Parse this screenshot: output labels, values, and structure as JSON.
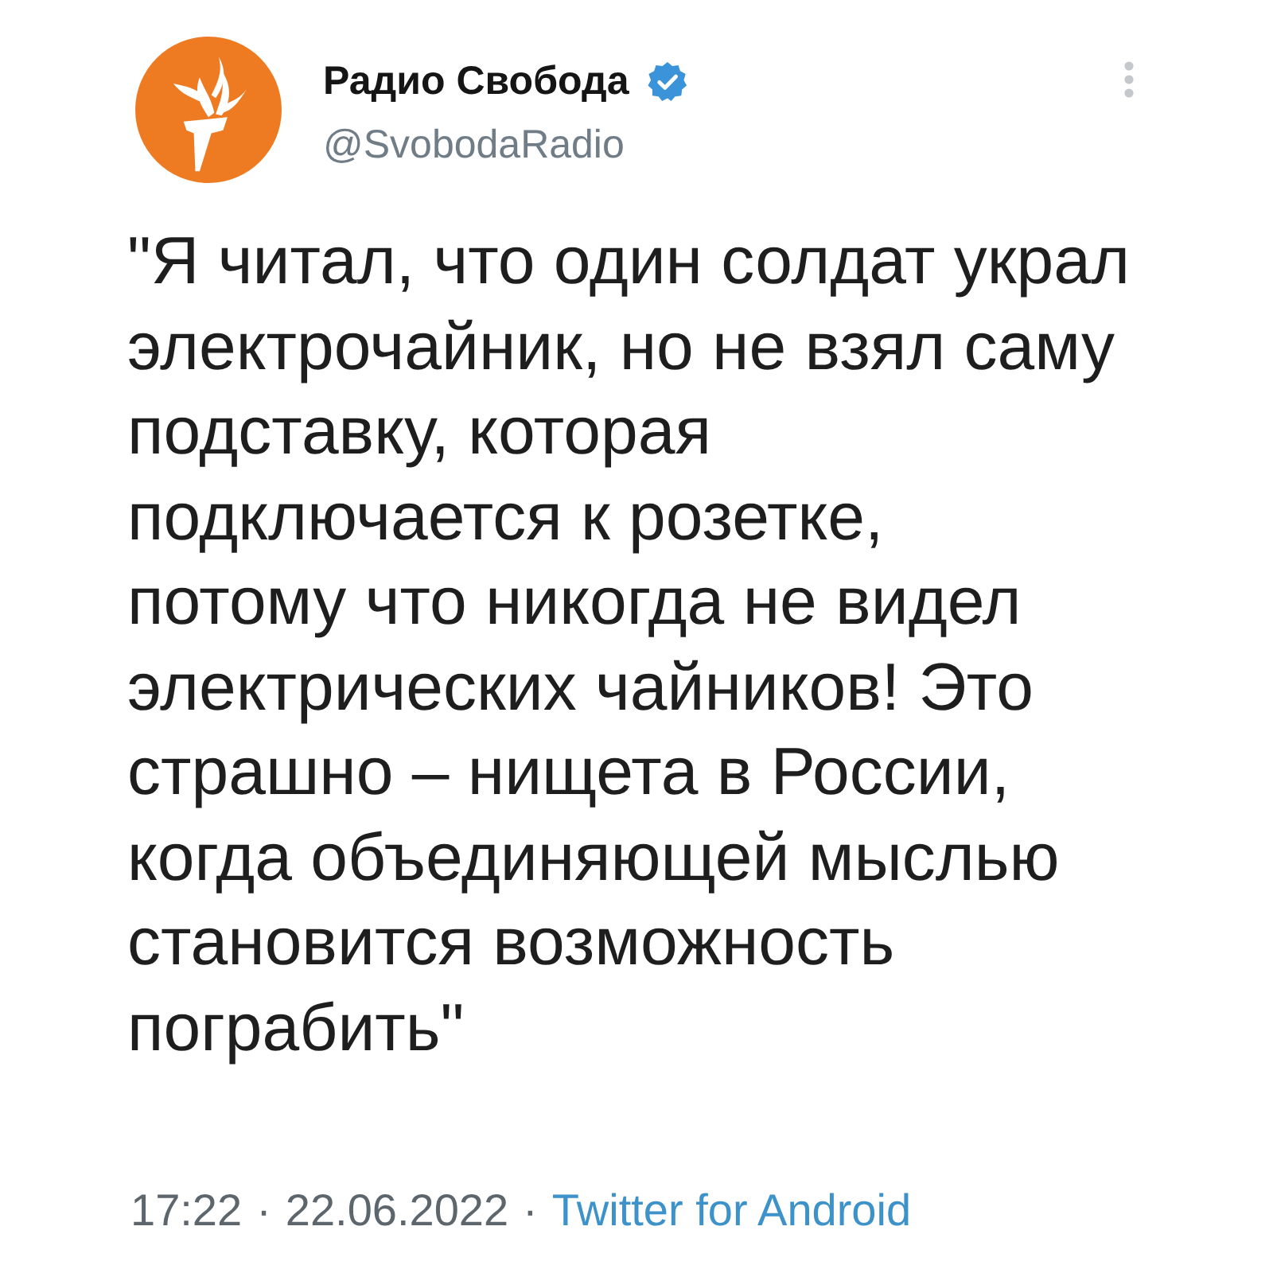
{
  "author": {
    "name": "Радио Свобода",
    "verified": true,
    "handle": "@SvobodaRadio"
  },
  "tweet": {
    "text": "\"Я читал, что один солдат украл\nэлектрочайник, но не взял саму\nподставку, которая\nподключается к розетке,\nпотому что никогда не видел\nэлектрических чайников! Это\nстрашно – нищета в России,\nкогда объединяющей мыслью\nстановится возможность\nпограбить\""
  },
  "footer": [
    {
      "kind": "time",
      "text": "17:22"
    },
    {
      "kind": "separator",
      "text": "·"
    },
    {
      "kind": "date",
      "text": "22.06.2022"
    },
    {
      "kind": "separator",
      "text": "·"
    },
    {
      "kind": "source",
      "text": "Twitter for Android"
    }
  ]
}
